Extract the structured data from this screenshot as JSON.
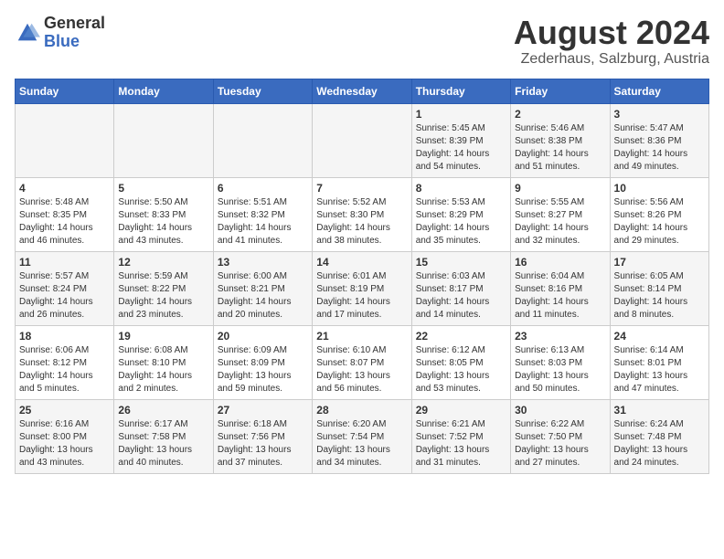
{
  "logo": {
    "general": "General",
    "blue": "Blue"
  },
  "title": "August 2024",
  "subtitle": "Zederhaus, Salzburg, Austria",
  "headers": [
    "Sunday",
    "Monday",
    "Tuesday",
    "Wednesday",
    "Thursday",
    "Friday",
    "Saturday"
  ],
  "weeks": [
    [
      {
        "day": "",
        "info": ""
      },
      {
        "day": "",
        "info": ""
      },
      {
        "day": "",
        "info": ""
      },
      {
        "day": "",
        "info": ""
      },
      {
        "day": "1",
        "info": "Sunrise: 5:45 AM\nSunset: 8:39 PM\nDaylight: 14 hours\nand 54 minutes."
      },
      {
        "day": "2",
        "info": "Sunrise: 5:46 AM\nSunset: 8:38 PM\nDaylight: 14 hours\nand 51 minutes."
      },
      {
        "day": "3",
        "info": "Sunrise: 5:47 AM\nSunset: 8:36 PM\nDaylight: 14 hours\nand 49 minutes."
      }
    ],
    [
      {
        "day": "4",
        "info": "Sunrise: 5:48 AM\nSunset: 8:35 PM\nDaylight: 14 hours\nand 46 minutes."
      },
      {
        "day": "5",
        "info": "Sunrise: 5:50 AM\nSunset: 8:33 PM\nDaylight: 14 hours\nand 43 minutes."
      },
      {
        "day": "6",
        "info": "Sunrise: 5:51 AM\nSunset: 8:32 PM\nDaylight: 14 hours\nand 41 minutes."
      },
      {
        "day": "7",
        "info": "Sunrise: 5:52 AM\nSunset: 8:30 PM\nDaylight: 14 hours\nand 38 minutes."
      },
      {
        "day": "8",
        "info": "Sunrise: 5:53 AM\nSunset: 8:29 PM\nDaylight: 14 hours\nand 35 minutes."
      },
      {
        "day": "9",
        "info": "Sunrise: 5:55 AM\nSunset: 8:27 PM\nDaylight: 14 hours\nand 32 minutes."
      },
      {
        "day": "10",
        "info": "Sunrise: 5:56 AM\nSunset: 8:26 PM\nDaylight: 14 hours\nand 29 minutes."
      }
    ],
    [
      {
        "day": "11",
        "info": "Sunrise: 5:57 AM\nSunset: 8:24 PM\nDaylight: 14 hours\nand 26 minutes."
      },
      {
        "day": "12",
        "info": "Sunrise: 5:59 AM\nSunset: 8:22 PM\nDaylight: 14 hours\nand 23 minutes."
      },
      {
        "day": "13",
        "info": "Sunrise: 6:00 AM\nSunset: 8:21 PM\nDaylight: 14 hours\nand 20 minutes."
      },
      {
        "day": "14",
        "info": "Sunrise: 6:01 AM\nSunset: 8:19 PM\nDaylight: 14 hours\nand 17 minutes."
      },
      {
        "day": "15",
        "info": "Sunrise: 6:03 AM\nSunset: 8:17 PM\nDaylight: 14 hours\nand 14 minutes."
      },
      {
        "day": "16",
        "info": "Sunrise: 6:04 AM\nSunset: 8:16 PM\nDaylight: 14 hours\nand 11 minutes."
      },
      {
        "day": "17",
        "info": "Sunrise: 6:05 AM\nSunset: 8:14 PM\nDaylight: 14 hours\nand 8 minutes."
      }
    ],
    [
      {
        "day": "18",
        "info": "Sunrise: 6:06 AM\nSunset: 8:12 PM\nDaylight: 14 hours\nand 5 minutes."
      },
      {
        "day": "19",
        "info": "Sunrise: 6:08 AM\nSunset: 8:10 PM\nDaylight: 14 hours\nand 2 minutes."
      },
      {
        "day": "20",
        "info": "Sunrise: 6:09 AM\nSunset: 8:09 PM\nDaylight: 13 hours\nand 59 minutes."
      },
      {
        "day": "21",
        "info": "Sunrise: 6:10 AM\nSunset: 8:07 PM\nDaylight: 13 hours\nand 56 minutes."
      },
      {
        "day": "22",
        "info": "Sunrise: 6:12 AM\nSunset: 8:05 PM\nDaylight: 13 hours\nand 53 minutes."
      },
      {
        "day": "23",
        "info": "Sunrise: 6:13 AM\nSunset: 8:03 PM\nDaylight: 13 hours\nand 50 minutes."
      },
      {
        "day": "24",
        "info": "Sunrise: 6:14 AM\nSunset: 8:01 PM\nDaylight: 13 hours\nand 47 minutes."
      }
    ],
    [
      {
        "day": "25",
        "info": "Sunrise: 6:16 AM\nSunset: 8:00 PM\nDaylight: 13 hours\nand 43 minutes."
      },
      {
        "day": "26",
        "info": "Sunrise: 6:17 AM\nSunset: 7:58 PM\nDaylight: 13 hours\nand 40 minutes."
      },
      {
        "day": "27",
        "info": "Sunrise: 6:18 AM\nSunset: 7:56 PM\nDaylight: 13 hours\nand 37 minutes."
      },
      {
        "day": "28",
        "info": "Sunrise: 6:20 AM\nSunset: 7:54 PM\nDaylight: 13 hours\nand 34 minutes."
      },
      {
        "day": "29",
        "info": "Sunrise: 6:21 AM\nSunset: 7:52 PM\nDaylight: 13 hours\nand 31 minutes."
      },
      {
        "day": "30",
        "info": "Sunrise: 6:22 AM\nSunset: 7:50 PM\nDaylight: 13 hours\nand 27 minutes."
      },
      {
        "day": "31",
        "info": "Sunrise: 6:24 AM\nSunset: 7:48 PM\nDaylight: 13 hours\nand 24 minutes."
      }
    ]
  ]
}
